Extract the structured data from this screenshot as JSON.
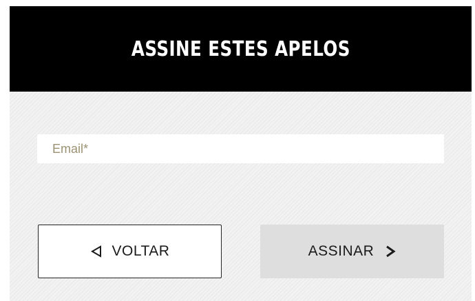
{
  "header": {
    "title": "ASSINE ESTES APELOS"
  },
  "form": {
    "email_placeholder": "Email*",
    "email_value": ""
  },
  "actions": {
    "back_label": "VOLTAR",
    "submit_label": "ASSINAR"
  },
  "icons": {
    "back": "triangle-left-icon",
    "submit": "chevron-right-icon"
  },
  "colors": {
    "header_bg": "#000000",
    "header_text": "#ffffff",
    "placeholder": "#9a9272",
    "submit_bg": "#dedede"
  }
}
